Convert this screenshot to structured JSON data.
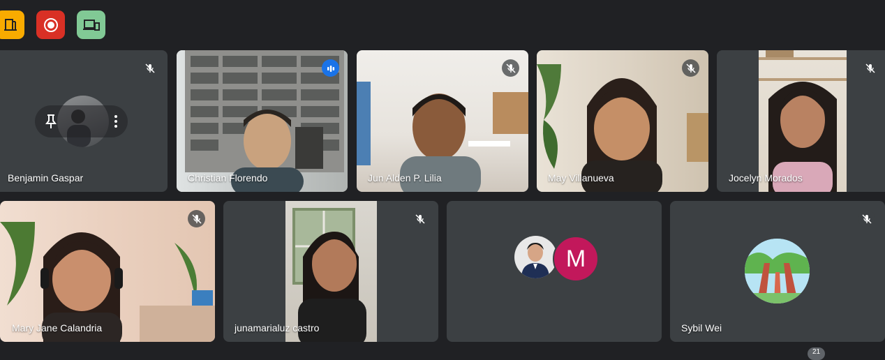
{
  "toolbar": {
    "buttons": [
      {
        "icon": "door-icon",
        "color": "#f9ab00"
      },
      {
        "icon": "record-icon",
        "color": "#d93025"
      },
      {
        "icon": "devices-icon",
        "color": "#81c995"
      }
    ]
  },
  "participants": [
    {
      "name": "Benjamin Gaspar",
      "muted": true,
      "pinned_menu": true
    },
    {
      "name": "Christian Florendo",
      "muted": false,
      "speaking": true
    },
    {
      "name": "Jun Alden P. Lilia",
      "muted": true
    },
    {
      "name": "May Villanueva",
      "muted": true
    },
    {
      "name": "Jocelyn Morados",
      "muted": true
    },
    {
      "name": "Mary Jane Calandria",
      "muted": true
    },
    {
      "name": "junamarialuz castro",
      "muted": true
    },
    {
      "name": "",
      "muted": false,
      "avatars": [
        "photo",
        "M"
      ]
    },
    {
      "name": "Sybil Wei",
      "muted": true
    }
  ],
  "group_tile": {
    "letter": "M",
    "letter_color": "#c2185b"
  },
  "participant_count": "21"
}
